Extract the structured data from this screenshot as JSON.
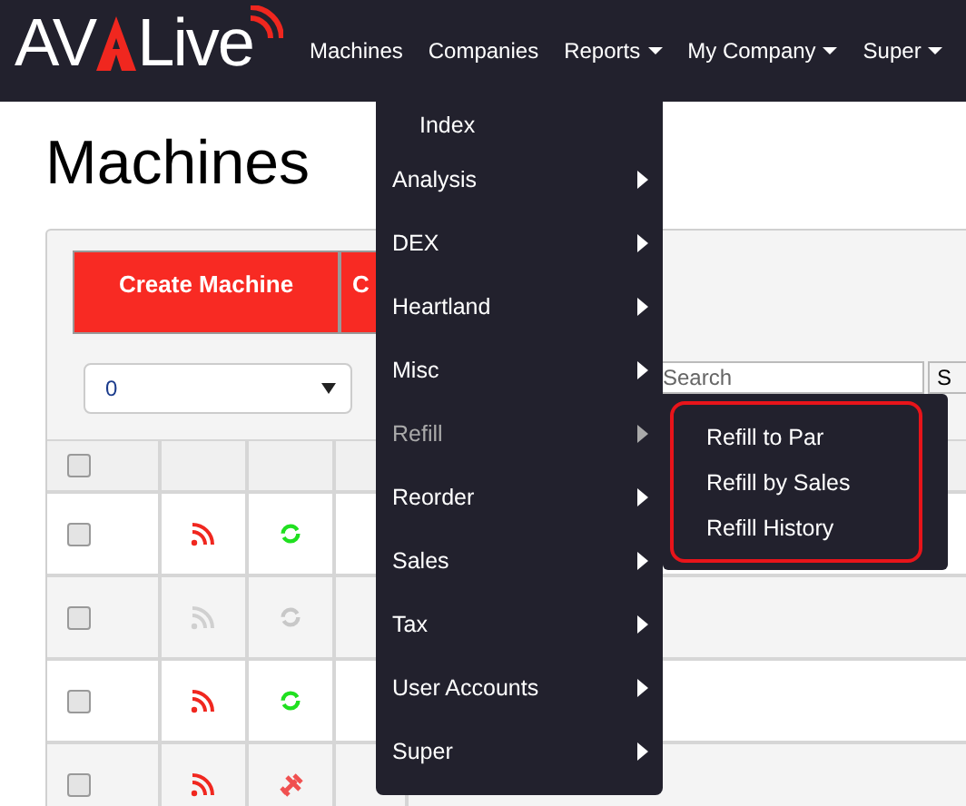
{
  "logo": {
    "left": "AV",
    "right": "Live"
  },
  "nav": [
    {
      "label": "Machines",
      "dropdown": false
    },
    {
      "label": "Companies",
      "dropdown": false
    },
    {
      "label": "Reports",
      "dropdown": true
    },
    {
      "label": "My Company",
      "dropdown": true
    },
    {
      "label": "Super",
      "dropdown": true
    }
  ],
  "page_title": "Machines",
  "buttons": [
    "Create Machine",
    "C"
  ],
  "filter": {
    "value": "0"
  },
  "search": {
    "placeholder": "Search",
    "button": "S"
  },
  "table": {
    "header_checked": false,
    "rows": [
      {
        "checked": false,
        "signal": {
          "on": true
        },
        "status": {
          "kind": "sync",
          "on": true
        }
      },
      {
        "checked": false,
        "signal": {
          "on": false
        },
        "status": {
          "kind": "sync",
          "on": false
        }
      },
      {
        "checked": false,
        "signal": {
          "on": true
        },
        "status": {
          "kind": "sync",
          "on": true
        }
      },
      {
        "checked": false,
        "signal": {
          "on": true
        },
        "status": {
          "kind": "tools",
          "on": true
        }
      }
    ]
  },
  "reports_menu": [
    {
      "label": "Index",
      "kind": "link",
      "expanded": false
    },
    {
      "label": "Analysis",
      "kind": "submenu",
      "expanded": false
    },
    {
      "label": "DEX",
      "kind": "submenu",
      "expanded": false
    },
    {
      "label": "Heartland",
      "kind": "submenu",
      "expanded": false
    },
    {
      "label": "Misc",
      "kind": "submenu",
      "expanded": false
    },
    {
      "label": "Refill",
      "kind": "submenu",
      "expanded": true
    },
    {
      "label": "Reorder",
      "kind": "submenu",
      "expanded": false
    },
    {
      "label": "Sales",
      "kind": "submenu",
      "expanded": false
    },
    {
      "label": "Tax",
      "kind": "submenu",
      "expanded": false
    },
    {
      "label": "User Accounts",
      "kind": "submenu",
      "expanded": false
    },
    {
      "label": "Super",
      "kind": "submenu",
      "expanded": false
    }
  ],
  "refill_submenu": {
    "highlighted": true,
    "items": [
      "Refill to Par",
      "Refill by Sales",
      "Refill History"
    ]
  }
}
